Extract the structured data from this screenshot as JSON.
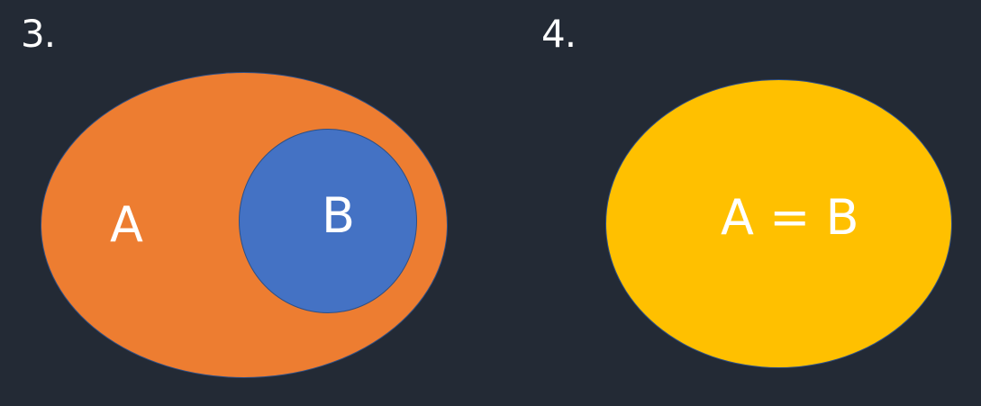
{
  "diagram3": {
    "number": "3.",
    "outer_label": "A",
    "inner_label": "B",
    "outer_color": "#ed7d31",
    "inner_color": "#4472c4"
  },
  "diagram4": {
    "number": "4.",
    "label": "A = B",
    "color": "#ffc000"
  },
  "colors": {
    "background": "#232a35",
    "text": "#ffffff",
    "outline": "#2e4f85"
  }
}
